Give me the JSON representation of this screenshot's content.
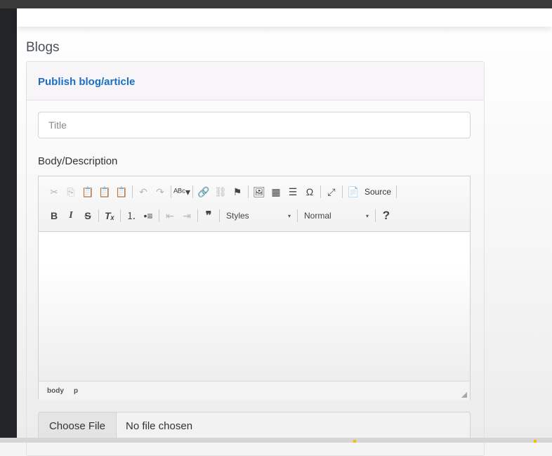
{
  "page": {
    "title": "Blogs"
  },
  "card": {
    "title": "Publish blog/article"
  },
  "form": {
    "title_placeholder": "Title",
    "body_label": "Body/Description",
    "file_button": "Choose File",
    "file_status": "No file chosen"
  },
  "editor": {
    "toolbar_row1": [
      {
        "name": "cut-icon",
        "glyph": "✂",
        "disabled": true
      },
      {
        "name": "copy-icon",
        "glyph": "⎘",
        "disabled": true
      },
      {
        "name": "paste-icon",
        "glyph": "📋",
        "disabled": false
      },
      {
        "name": "paste-text-icon",
        "glyph": "📋",
        "disabled": false
      },
      {
        "name": "paste-word-icon",
        "glyph": "📋",
        "disabled": false
      },
      {
        "sep": true
      },
      {
        "name": "undo-icon",
        "glyph": "↶",
        "disabled": true
      },
      {
        "name": "redo-icon",
        "glyph": "↷",
        "disabled": true
      },
      {
        "sep": true
      },
      {
        "name": "spellcheck-icon",
        "glyph": "ᴬᴮᶜ▾",
        "disabled": false
      },
      {
        "sep": true
      },
      {
        "name": "link-icon",
        "glyph": "🔗",
        "disabled": false
      },
      {
        "name": "unlink-icon",
        "glyph": "⛓",
        "disabled": true
      },
      {
        "name": "anchor-flag-icon",
        "glyph": "⚑",
        "disabled": false
      },
      {
        "sep": true
      },
      {
        "name": "image-icon",
        "glyph": "🖼",
        "disabled": false
      },
      {
        "name": "table-icon",
        "glyph": "▦",
        "disabled": false
      },
      {
        "name": "horizontal-line-icon",
        "glyph": "☰",
        "disabled": false
      },
      {
        "name": "special-char-icon",
        "glyph": "Ω",
        "disabled": false
      },
      {
        "sep": true
      },
      {
        "name": "maximize-icon",
        "glyph": "⤢",
        "disabled": false
      },
      {
        "sep": true
      },
      {
        "name": "source-icon",
        "glyph": "📄",
        "disabled": false
      }
    ],
    "source_label": "Source",
    "toolbar_row2": [
      {
        "name": "bold-icon",
        "glyph": "B",
        "disabled": false,
        "style": "font-weight:bold;font-family:'Liberation Sans',sans-serif;"
      },
      {
        "name": "italic-icon",
        "glyph": "I",
        "disabled": false,
        "style": "font-style:italic;font-weight:bold;font-family:'Liberation Serif',serif;"
      },
      {
        "name": "strikethrough-icon",
        "glyph": "S",
        "disabled": false,
        "style": "text-decoration:line-through;font-weight:bold;"
      },
      {
        "sep": true
      },
      {
        "name": "remove-format-icon",
        "glyph": "Tₓ",
        "disabled": false,
        "style": "font-style:italic;font-weight:bold;"
      },
      {
        "sep": true
      },
      {
        "name": "numbered-list-icon",
        "glyph": "⒈",
        "disabled": false
      },
      {
        "name": "bulleted-list-icon",
        "glyph": "•≡",
        "disabled": false
      },
      {
        "sep": true
      },
      {
        "name": "decrease-indent-icon",
        "glyph": "⇤",
        "disabled": true
      },
      {
        "name": "increase-indent-icon",
        "glyph": "⇥",
        "disabled": true
      },
      {
        "sep": true
      },
      {
        "name": "blockquote-icon",
        "glyph": "❞",
        "disabled": false,
        "style": "font-weight:bold;font-size:16px;"
      },
      {
        "sep": true
      }
    ],
    "styles_combo": "Styles",
    "format_combo": "Normal",
    "help_glyph": "?",
    "path": [
      "body",
      "p"
    ]
  },
  "colors": {
    "accent": "#1a6fc4",
    "sidebar": "#222428",
    "topbar": "#3a3a3a"
  }
}
